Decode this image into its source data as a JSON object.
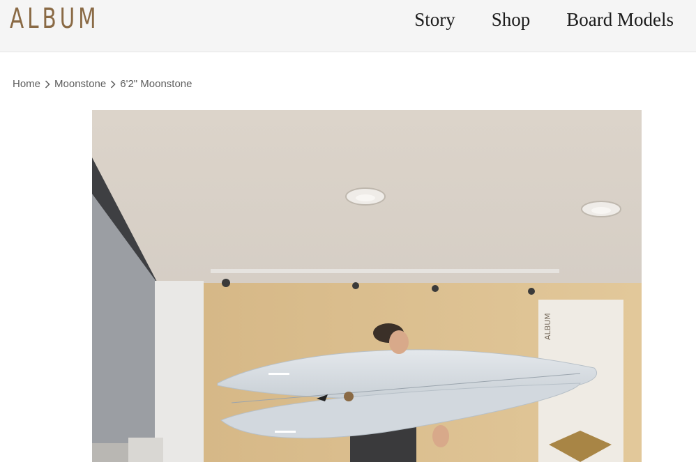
{
  "header": {
    "logo": "ALBUM",
    "nav": [
      {
        "label": "Story"
      },
      {
        "label": "Shop"
      },
      {
        "label": "Board Models"
      }
    ]
  },
  "breadcrumb": {
    "items": [
      "Home",
      "Moonstone"
    ],
    "current": "6'2\" Moonstone",
    "separator_icon": "chevron-right-icon"
  },
  "product_image": {
    "banner_text": "ALBUM"
  }
}
